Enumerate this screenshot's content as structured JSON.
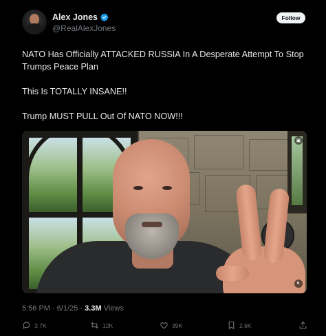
{
  "author": {
    "display_name": "Alex Jones",
    "handle": "@RealAlexJones",
    "verified": true
  },
  "follow_button": {
    "label": "Follow"
  },
  "tweet": {
    "lines": [
      "NATO Has Officially ATTACKED RUSSIA In A Desperate Attempt To Stop Trumps Peace Plan",
      "This Is TOTALLY INSANE!!",
      "Trump MUST PULL Out Of NATO NOW!!!"
    ]
  },
  "meta": {
    "time": "5:56 PM",
    "date": "6/1/25",
    "separator": "·",
    "views_count": "3.3M",
    "views_label": "Views"
  },
  "actions": {
    "replies": "3.7K",
    "reposts": "12K",
    "likes": "39K",
    "bookmarks": "2.6K"
  },
  "colors": {
    "background": "#000000",
    "text": "#e7e9ea",
    "muted": "#71767b",
    "verified": "#1d9bf0",
    "follow_bg": "#eff3f4"
  },
  "icons": {
    "verified": "verified-badge-icon",
    "reply": "reply-icon",
    "repost": "repost-icon",
    "like": "heart-icon",
    "bookmark": "bookmark-icon",
    "share": "share-icon",
    "media_menu": "media-options-icon",
    "mute": "muted-speaker-icon"
  }
}
